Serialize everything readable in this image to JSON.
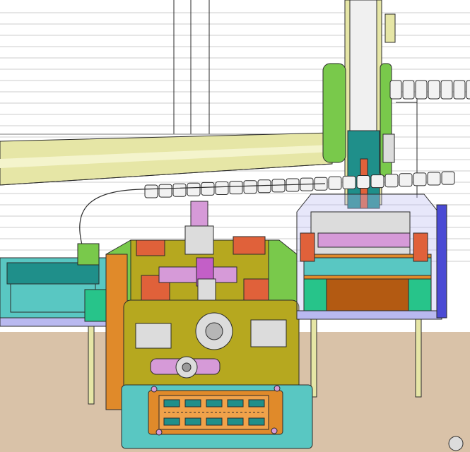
{
  "scene": {
    "kind": "cad-assembly-render",
    "colors": {
      "background": "#ffffff",
      "floor": "#d9c2a8",
      "scan_line": "#c7c7c7",
      "rail_yellow": "#e6e6a6",
      "olive": "#b6a81f",
      "green": "#79c94b",
      "teal": "#59c7c2",
      "dark_teal": "#1f8f8a",
      "orange": "#e08a2a",
      "red_orange": "#e0613a",
      "pink": "#d69ad8",
      "magenta": "#c35fc7",
      "lavender": "#b9b9f0",
      "gray_metal": "#d6d6d6",
      "dark_outline": "#2b2b2b"
    },
    "parts": [
      "top-frame",
      "overhead-rail",
      "vertical-column",
      "cable-drag-chain-right",
      "cable-drag-chain-middle",
      "left-tray-station",
      "center-press-station",
      "right-tray-station",
      "front-fixture-plate",
      "floor"
    ]
  }
}
